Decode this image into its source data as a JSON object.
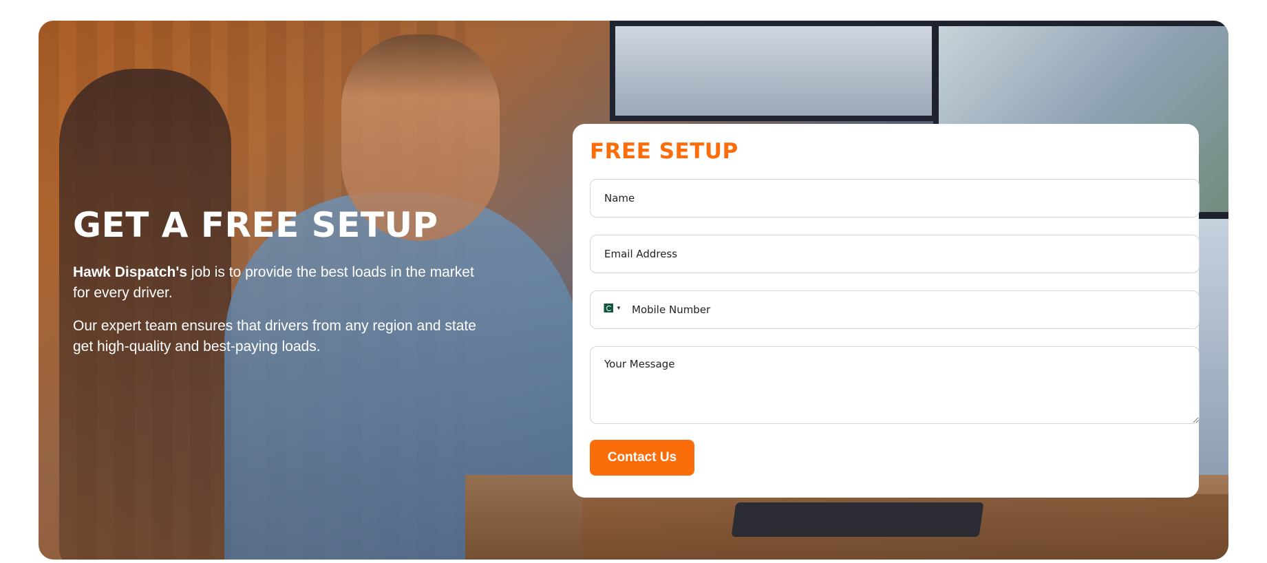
{
  "hero": {
    "title": "GET A FREE SETUP",
    "paragraph1_bold": "Hawk Dispatch's",
    "paragraph1_rest": " job is to provide the best loads in the market for every driver.",
    "paragraph2": "Our expert team ensures that drivers from any region and state get high-quality and best-paying loads."
  },
  "form": {
    "title": "FREE SETUP",
    "name_placeholder": "Name",
    "email_placeholder": "Email Address",
    "phone_placeholder": "Mobile Number",
    "phone_country_icon": "pakistan-flag-icon",
    "message_placeholder": "Your Message",
    "submit_label": "Contact Us"
  },
  "colors": {
    "accent": "#fb6c0b",
    "text_on_image": "#ffffff",
    "card_background": "#ffffff"
  }
}
